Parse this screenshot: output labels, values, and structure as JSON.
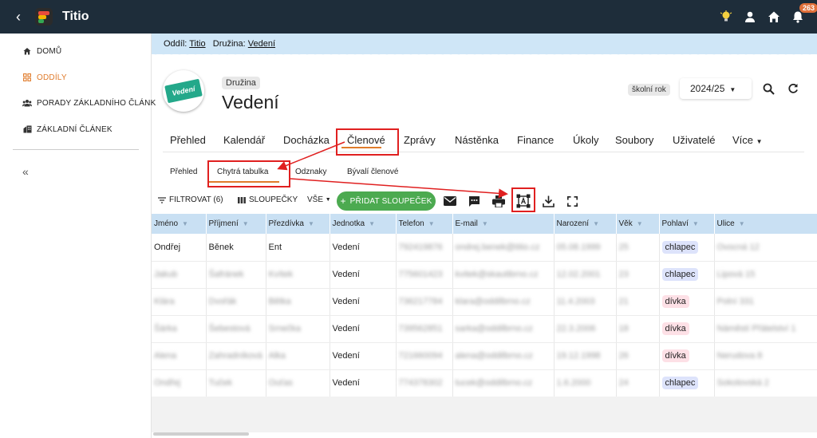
{
  "app": {
    "title": "Titio",
    "notification_count": "263"
  },
  "sidebar": {
    "items": [
      {
        "label": "DOMŮ",
        "icon": "home-icon"
      },
      {
        "label": "ODDÍLY",
        "icon": "grid-icon",
        "active": true
      },
      {
        "label": "PORADY ZÁKLADNÍHO ČLÁNK",
        "icon": "group-icon"
      },
      {
        "label": "ZÁKLADNÍ ČLÁNEK",
        "icon": "building-icon"
      }
    ],
    "collapse": "«"
  },
  "breadcrumb": {
    "oddil_label": "Oddíl:",
    "oddil_value": "Titio",
    "druzina_label": "Družina:",
    "druzina_value": "Vedení"
  },
  "header": {
    "chip": "Družina",
    "title": "Vedení",
    "logo_text": "Vedení",
    "school_year_label": "školní rok",
    "school_year_value": "2024/25"
  },
  "tabs": [
    "Přehled",
    "Kalendář",
    "Docházka",
    "Členové",
    "Zprávy",
    "Nástěnka",
    "Finance",
    "Úkoly",
    "Soubory",
    "Uživatelé",
    "Více"
  ],
  "active_tab": "Členové",
  "subtabs": [
    "Přehled",
    "Chytrá tabulka",
    "Odznaky",
    "Bývalí členové"
  ],
  "active_subtab": "Chytrá tabulka",
  "toolbar": {
    "filter": "FILTROVAT (6)",
    "columns": "SLOUPEČKY",
    "all": "VŠE",
    "add_columns": "PŘIDAT SLOUPEČEK"
  },
  "table": {
    "headers": [
      "Jméno",
      "Příjmení",
      "Přezdívka",
      "Jednotka",
      "Telefon",
      "E-mail",
      "Narození",
      "Věk",
      "Pohlaví",
      "Ulice"
    ],
    "rows": [
      {
        "jmeno": "Ondřej",
        "prijmeni": "Běnek",
        "prezdivka": "Ent",
        "jednotka": "Vedení",
        "telefon": "792419876",
        "email": "ondrej.benek@titio.cz",
        "narozeni": "05.08.1999",
        "vek": "25",
        "pohlavi": "chlapec",
        "ulice": "Ovocná 12",
        "blur": false
      },
      {
        "jmeno": "Jakub",
        "prijmeni": "Šafránek",
        "prezdivka": "Kvítek",
        "jednotka": "Vedení",
        "telefon": "775601423",
        "email": "kvitek@skautibrno.cz",
        "narozeni": "12.02.2001",
        "vek": "23",
        "pohlavi": "chlapec",
        "ulice": "Lipová 15",
        "blur": true
      },
      {
        "jmeno": "Klára",
        "prijmeni": "Dvořák",
        "prezdivka": "Bětka",
        "jednotka": "Vedení",
        "telefon": "736217784",
        "email": "klara@oddilbrno.cz",
        "narozeni": "11.4.2003",
        "vek": "21",
        "pohlavi": "dívka",
        "ulice": "Polní 331",
        "blur": true
      },
      {
        "jmeno": "Šárka",
        "prijmeni": "Šebestová",
        "prezdivka": "Srnečka",
        "jednotka": "Vedení",
        "telefon": "739562851",
        "email": "sarka@oddilbrno.cz",
        "narozeni": "22.3.2006",
        "vek": "18",
        "pohlavi": "dívka",
        "ulice": "Náměstí Přátelství 1",
        "blur": true
      },
      {
        "jmeno": "Alena",
        "prijmeni": "Zahradníková",
        "prezdivka": "Alka",
        "jednotka": "Vedení",
        "telefon": "721660094",
        "email": "alena@oddilbrno.cz",
        "narozeni": "19.12.1998",
        "vek": "26",
        "pohlavi": "dívka",
        "ulice": "Nerudova 8",
        "blur": true
      },
      {
        "jmeno": "Ondřej",
        "prijmeni": "Tuček",
        "prezdivka": "Ouťas",
        "jednotka": "Vedení",
        "telefon": "774378302",
        "email": "tucek@oddilbrno.cz",
        "narozeni": "1.6.2000",
        "vek": "24",
        "pohlavi": "chlapec",
        "ulice": "Sokolovská 2",
        "blur": true
      }
    ]
  },
  "colors": {
    "topbar": "#1e2d3a",
    "accent": "#e07b2b",
    "header_row": "#c9e0f3",
    "add_button": "#4caa50",
    "annotation": "#e02020"
  }
}
